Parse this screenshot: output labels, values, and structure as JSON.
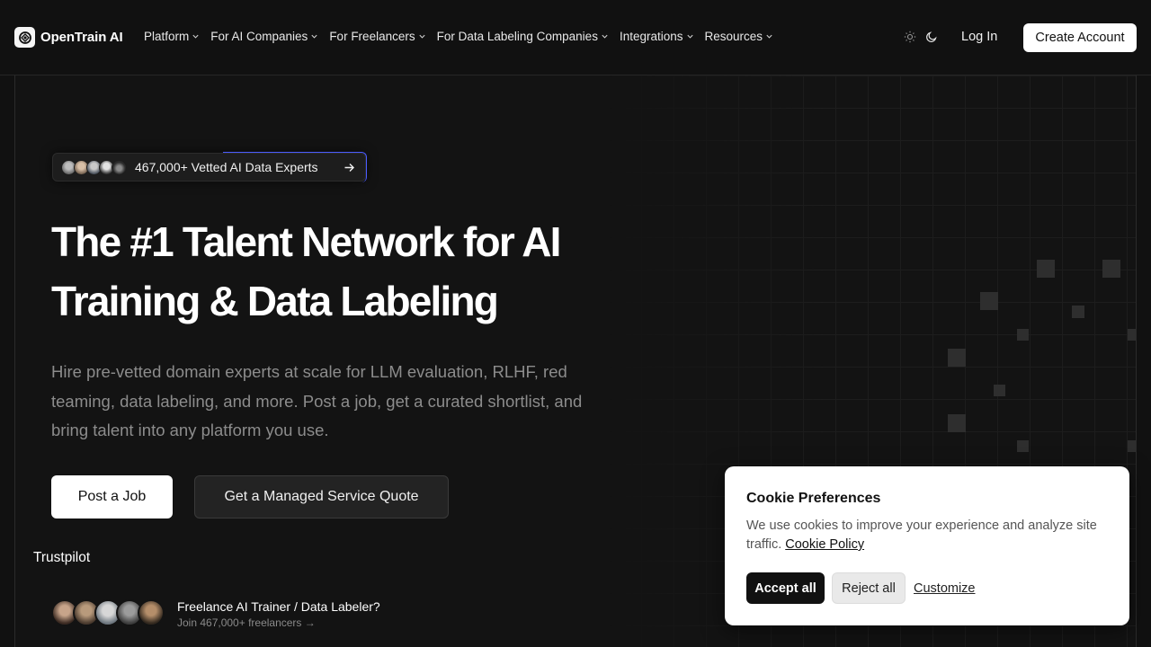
{
  "header": {
    "brand": "OpenTrain AI",
    "nav": [
      {
        "label": "Platform"
      },
      {
        "label": "For AI Companies"
      },
      {
        "label": "For Freelancers"
      },
      {
        "label": "For Data Labeling Companies"
      },
      {
        "label": "Integrations"
      },
      {
        "label": "Resources"
      }
    ],
    "login_label": "Log In",
    "create_label": "Create Account",
    "icons": {
      "light": "sun-icon",
      "dark": "moon-icon",
      "dropdown": "chevron-down-icon"
    }
  },
  "hero": {
    "badge_text": "467,000+ Vetted AI Data Experts",
    "title_line1": "The #1 Talent Network for AI",
    "title_line2": "Training & Data Labeling",
    "subtitle": "Hire pre-vetted domain experts at scale for LLM evaluation, RLHF, red teaming, data labeling, and more. Post a job, get a curated shortlist, and bring talent into any platform you use.",
    "primary_cta": "Post a Job",
    "secondary_cta": "Get a Managed Service Quote",
    "trustpilot": "Trustpilot"
  },
  "freelancer": {
    "title": "Freelance AI Trainer / Data Labeler?",
    "subtitle": "Join 467,000+ freelancers →"
  },
  "cookie": {
    "title": "Cookie Preferences",
    "text": "We use cookies to improve your experience and analyze site traffic.",
    "link": "Cookie Policy",
    "accept": "Accept all",
    "reject": "Reject all",
    "customize": "Customize"
  },
  "colors": {
    "background": "#111111",
    "accent": "#4b5cff",
    "text_muted": "#8c8c8c"
  }
}
